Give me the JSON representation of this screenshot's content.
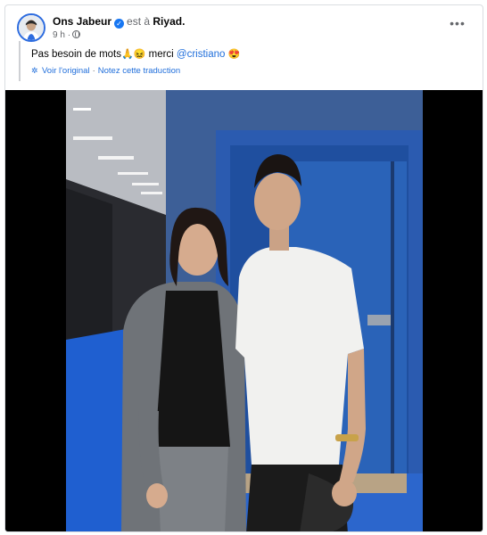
{
  "post": {
    "author": "Ons Jabeur",
    "location_prefix": "est à",
    "location": "Riyad.",
    "time": "9 h",
    "dot": "·",
    "text_before": "Pas besoin de mots",
    "emoji_1": "🙏😖",
    "text_middle": " merci ",
    "mention": "@cristiano",
    "emoji_2": " 😍",
    "see_original": "Voir l'original",
    "separator": "·",
    "rate_translation": "Notez cette traduction"
  },
  "icons": {
    "verified": "verified-badge-icon",
    "globe": "globe-icon",
    "more": "more-options-icon",
    "translate": "translate-gear-icon"
  },
  "colors": {
    "link": "#216fdb",
    "verified": "#1877f2",
    "secondary_text": "#65676b"
  }
}
